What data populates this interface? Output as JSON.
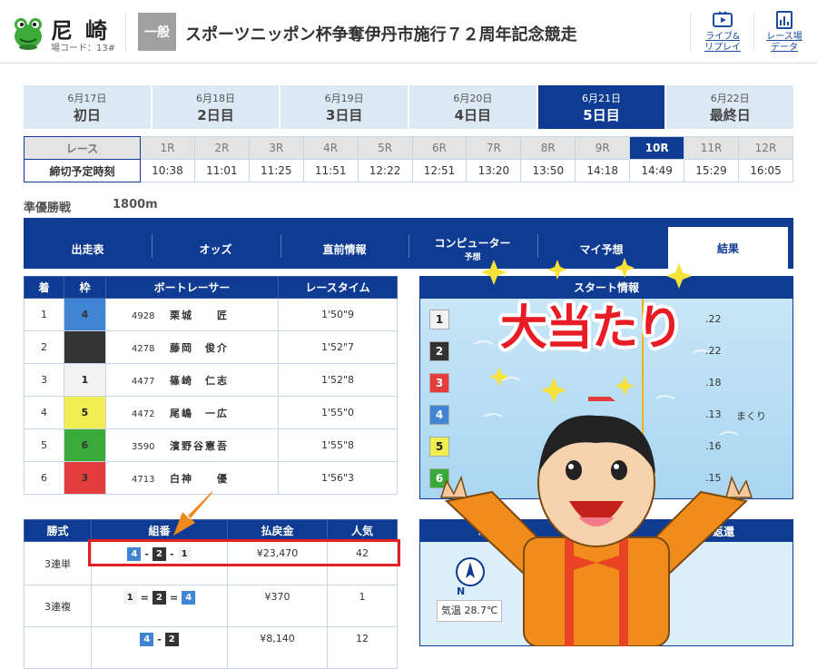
{
  "header": {
    "venue_name": "尼崎",
    "venue_code": "場コード：13#",
    "grade": "一般",
    "race_name": "スポーツニッポン杯争奪伊丹市施行７２周年記念競走",
    "buttons": [
      {
        "label1": "ライブ&",
        "label2": "リプレイ",
        "icon": "tv-play-icon"
      },
      {
        "label1": "レース場",
        "label2": "データ",
        "icon": "chart-data-icon"
      }
    ]
  },
  "days": [
    {
      "date": "6月17日",
      "label": "初日"
    },
    {
      "date": "6月18日",
      "label": "2日目"
    },
    {
      "date": "6月19日",
      "label": "3日目"
    },
    {
      "date": "6月20日",
      "label": "4日目"
    },
    {
      "date": "6月21日",
      "label": "5日目",
      "active": true
    },
    {
      "date": "6月22日",
      "label": "最終日"
    }
  ],
  "race_table": {
    "race_header": "レース",
    "time_header": "締切予定時刻",
    "races": [
      "1R",
      "2R",
      "3R",
      "4R",
      "5R",
      "6R",
      "7R",
      "8R",
      "9R",
      "10R",
      "11R",
      "12R"
    ],
    "times": [
      "10:38",
      "11:01",
      "11:25",
      "11:51",
      "12:22",
      "12:51",
      "13:20",
      "13:50",
      "14:18",
      "14:49",
      "15:29",
      "16:05"
    ],
    "active_index": 9
  },
  "race_info": {
    "stage": "準優勝戦",
    "distance": "1800m"
  },
  "nav": {
    "tabs": [
      {
        "label": "出走表"
      },
      {
        "label": "オッズ"
      },
      {
        "label": "直前情報"
      },
      {
        "label": "コンピューター",
        "sub": "予想"
      },
      {
        "label": "マイ予想"
      },
      {
        "label": "結果",
        "active": true
      }
    ]
  },
  "result": {
    "headers": [
      "着",
      "枠",
      "ボートレーサー",
      "レースタイム"
    ],
    "rows": [
      {
        "rank": "1",
        "waku": "4",
        "reg": "4928",
        "name": "栗城　　匠",
        "time": "1'50\"9"
      },
      {
        "rank": "2",
        "waku": "2",
        "reg": "4278",
        "name": "藤岡　俊介",
        "time": "1'52\"7"
      },
      {
        "rank": "3",
        "waku": "1",
        "reg": "4477",
        "name": "篠崎　仁志",
        "time": "1'52\"8"
      },
      {
        "rank": "4",
        "waku": "5",
        "reg": "4472",
        "name": "尾嶋　一広",
        "time": "1'55\"0"
      },
      {
        "rank": "5",
        "waku": "6",
        "reg": "3590",
        "name": "濱野谷憲吾",
        "time": "1'55\"8"
      },
      {
        "rank": "6",
        "waku": "3",
        "reg": "4713",
        "name": "白神　　優",
        "time": "1'56\"3"
      }
    ]
  },
  "start_info": {
    "title": "スタート情報",
    "lanes": [
      {
        "lane": "1",
        "st": ".22",
        "note": ""
      },
      {
        "lane": "2",
        "st": ".22",
        "note": ""
      },
      {
        "lane": "3",
        "st": ".18",
        "note": ""
      },
      {
        "lane": "4",
        "st": ".13",
        "note": "まくり"
      },
      {
        "lane": "5",
        "st": ".16",
        "note": ""
      },
      {
        "lane": "6",
        "st": ".15",
        "note": ""
      }
    ]
  },
  "payout": {
    "headers": [
      "勝式",
      "組番",
      "払戻金",
      "人気"
    ],
    "rows": [
      {
        "type": "3連単",
        "combo": [
          "4",
          "-",
          "2",
          "-",
          "1"
        ],
        "amount": "¥23,470",
        "pop": "42"
      },
      {
        "type": "3連複",
        "combo": [
          "1",
          "=",
          "2",
          "=",
          "4"
        ],
        "amount": "¥370",
        "pop": "1"
      },
      {
        "type": "",
        "combo": [
          "4",
          "-",
          "2"
        ],
        "amount": "¥8,140",
        "pop": "12"
      }
    ]
  },
  "weather": {
    "title_left": "水面",
    "title_right": "返還",
    "temp_label": "気温",
    "temp_value": "28.7℃",
    "compass": "N"
  },
  "overlay": {
    "text": "大当たり"
  }
}
